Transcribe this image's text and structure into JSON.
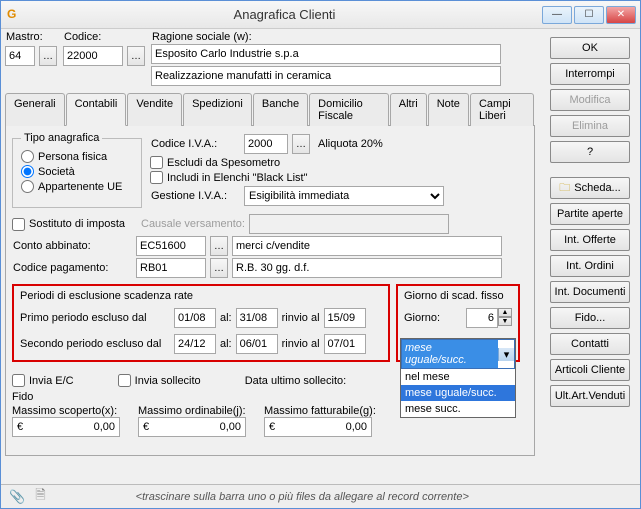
{
  "window": {
    "title": "Anagrafica Clienti"
  },
  "header": {
    "mastro_lbl": "Mastro:",
    "codice_lbl": "Codice:",
    "ragione_lbl": "Ragione sociale (w):",
    "mastro": "64",
    "codice": "22000",
    "ragione1": "Esposito Carlo Industrie s.p.a",
    "ragione2": "Realizzazione manufatti in ceramica"
  },
  "tabs": [
    "Generali",
    "Contabili",
    "Vendite",
    "Spedizioni",
    "Banche",
    "Domicilio Fiscale",
    "Altri",
    "Note",
    "Campi Liberi"
  ],
  "tipo": {
    "legend": "Tipo anagrafica",
    "r1": "Persona fisica",
    "r2": "Società",
    "r3": "Appartenente UE"
  },
  "iva": {
    "codice_lbl": "Codice I.V.A.:",
    "codice": "2000",
    "descr": "Aliquota 20%",
    "escludi": "Escludi da Spesometro",
    "includi": "Includi in Elenchi \"Black List\"",
    "gestione_lbl": "Gestione I.V.A.:",
    "gestione": "Esigibilità immediata"
  },
  "sost": {
    "lbl": "Sostituto di imposta",
    "causale_lbl": "Causale versamento:"
  },
  "conto": {
    "lbl": "Conto abbinato:",
    "val": "EC51600",
    "descr": "merci c/vendite"
  },
  "pag": {
    "lbl": "Codice pagamento:",
    "val": "RB01",
    "descr": "R.B. 30 gg. d.f."
  },
  "periodi": {
    "legend": "Periodi di esclusione scadenza rate",
    "p1_lbl": "Primo periodo escluso dal",
    "al": "al:",
    "rinvio": "rinvio al",
    "p1_from": "01/08",
    "p1_to": "31/08",
    "p1_rin": "15/09",
    "p2_lbl": "Secondo periodo escluso dal",
    "p2_from": "24/12",
    "p2_to": "06/01",
    "p2_rin": "07/01"
  },
  "scad": {
    "legend": "Giorno di scad. fisso",
    "giorno_lbl": "Giorno:",
    "giorno": "6",
    "selected": "mese uguale/succ.",
    "opts": [
      "nel mese",
      "mese uguale/succ.",
      "mese succ."
    ]
  },
  "bottom": {
    "invia_ec": "Invia E/C",
    "invia_soll": "Invia sollecito",
    "data_ult": "Data ultimo sollecito:",
    "fido": "Fido",
    "mx": "Massimo scoperto(x):",
    "mj": "Massimo ordinabile(j):",
    "mg": "Massimo fatturabile(g):",
    "eur": "€",
    "zero": "0,00"
  },
  "btns": {
    "ok": "OK",
    "int": "Interrompi",
    "mod": "Modifica",
    "elim": "Elimina",
    "q": "?",
    "scheda": "Scheda...",
    "partite": "Partite aperte",
    "off": "Int. Offerte",
    "ord": "Int. Ordini",
    "doc": "Int. Documenti",
    "fido": "Fido...",
    "cont": "Contatti",
    "artcli": "Articoli Cliente",
    "ultart": "Ult.Art.Venduti"
  },
  "status": {
    "hint": "<trascinare sulla barra uno o più files da allegare al record corrente>"
  }
}
